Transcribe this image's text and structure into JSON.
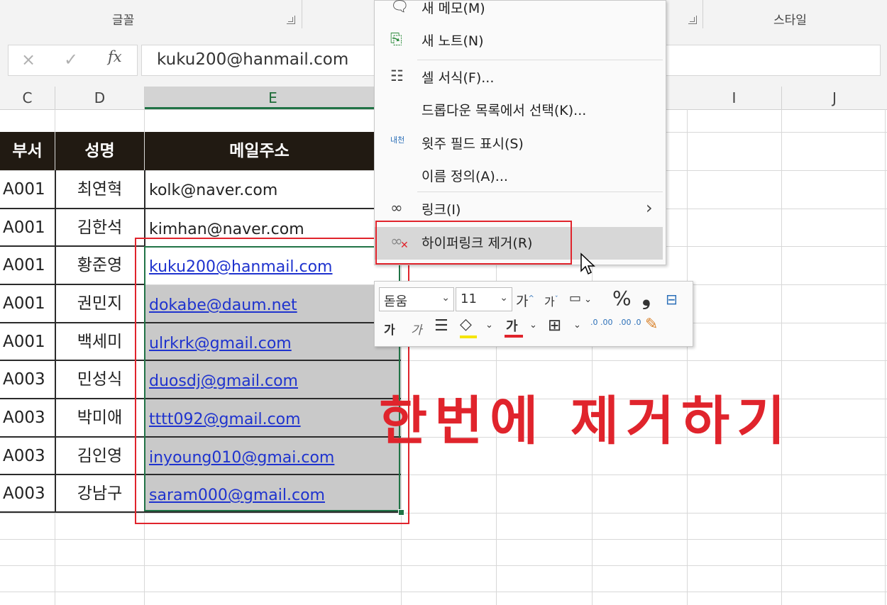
{
  "ribbon": {
    "group_font": "글꼴",
    "group_style": "스타일"
  },
  "formula_bar": {
    "cancel_icon": "×",
    "enter_icon": "✓",
    "fx_label": "fx",
    "value": "kuku200@hanmail.com"
  },
  "columns": [
    "C",
    "D",
    "E",
    "I",
    "J"
  ],
  "table": {
    "headers": [
      "부서",
      "성명",
      "메일주소"
    ],
    "rows": [
      {
        "dept": "A001",
        "name": "최연혁",
        "email": "kolk@naver.com"
      },
      {
        "dept": "A001",
        "name": "김한석",
        "email": "kimhan@naver.com"
      },
      {
        "dept": "A001",
        "name": "황준영",
        "email": "kuku200@hanmail.com"
      },
      {
        "dept": "A001",
        "name": "권민지",
        "email": "dokabe@daum.net"
      },
      {
        "dept": "A001",
        "name": "백세미",
        "email": "ulrkrk@gmail.com"
      },
      {
        "dept": "A003",
        "name": "민성식",
        "email": "duosdj@gmail.com"
      },
      {
        "dept": "A003",
        "name": "박미애",
        "email": "tttt092@gmail.com"
      },
      {
        "dept": "A003",
        "name": "김인영",
        "email": "inyoung010@gmai.com"
      },
      {
        "dept": "A003",
        "name": "강남구",
        "email": "saram000@gmail.com"
      }
    ]
  },
  "context_menu": {
    "items": [
      {
        "label": "새 메모(M)",
        "icon": "comment-icon"
      },
      {
        "label": "새 노트(N)",
        "icon": "new-note-icon"
      },
      {
        "label": "셀 서식(F)...",
        "icon": "format-cells-icon"
      },
      {
        "label": "드롭다운 목록에서 선택(K)...",
        "icon": ""
      },
      {
        "label": "윗주 필드 표시(S)",
        "icon": "phonetic-icon",
        "icon_text": "내천"
      },
      {
        "label": "이름 정의(A)...",
        "icon": ""
      },
      {
        "label": "링크(I)",
        "icon": "link-icon",
        "submenu": "›"
      },
      {
        "label": "하이퍼링크 제거(R)",
        "icon": "remove-link-icon"
      }
    ]
  },
  "mini_toolbar": {
    "font_name": "돋움",
    "font_size": "11",
    "grow_font": "가",
    "shrink_font": "가",
    "percent": "%",
    "comma": "❟",
    "bold": "가",
    "italic": "가",
    "font_color_letter": "가",
    "dec_increase": ".0 .00",
    "dec_decrease": ".00 .0"
  },
  "annotation": "한번에 제거하기",
  "colors": {
    "accent_red": "#e0242c",
    "header_bg": "#211a12",
    "link_blue": "#1f33ce",
    "excel_green": "#217346"
  }
}
